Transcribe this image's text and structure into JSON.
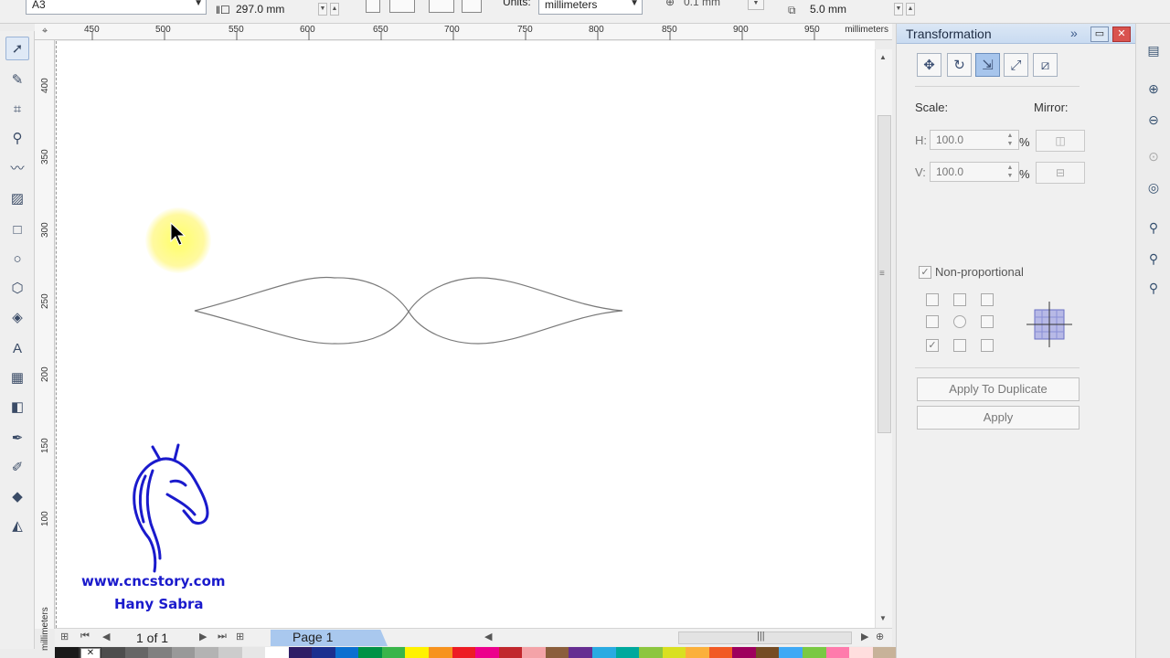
{
  "property_bar": {
    "paper_size": "A3",
    "page_height": "297.0 mm",
    "units_label": "Units:",
    "units_value": "millimeters",
    "nudge": "0.1 mm",
    "duplicate_offset": "5.0 mm"
  },
  "toolbox": {
    "tools": [
      "pick-tool-icon",
      "shape-tool-icon",
      "crop-tool-icon",
      "zoom-tool-icon",
      "freehand-tool-icon",
      "smart-fill-tool-icon",
      "rectangle-tool-icon",
      "ellipse-tool-icon",
      "polygon-tool-icon",
      "basic-shapes-tool-icon",
      "text-tool-icon",
      "table-tool-icon",
      "blend-tool-icon",
      "eyedropper-tool-icon",
      "outline-tool-icon",
      "fill-tool-icon",
      "interactive-fill-tool-icon"
    ]
  },
  "rulers": {
    "horizontal_ticks": [
      "450",
      "500",
      "550",
      "600",
      "650",
      "700",
      "750",
      "800",
      "850",
      "900",
      "950"
    ],
    "horizontal_unit": "millimeters",
    "vertical_ticks": [
      "400",
      "350",
      "300",
      "250",
      "200",
      "150",
      "100"
    ],
    "vertical_unit": "millimeters"
  },
  "logo": {
    "site": "www.cncstory.com",
    "author": "Hany Sabra"
  },
  "page_nav": {
    "count": "1 of 1",
    "current_tab": "Page 1"
  },
  "palette": {
    "colors": [
      "#1a1a1a",
      "#333333",
      "#4d4d4d",
      "#666666",
      "#808080",
      "#999999",
      "#b3b3b3",
      "#cccccc",
      "#e6e6e6",
      "#ffffff",
      "#2e1d66",
      "#1b2f8f",
      "#0b6fd0",
      "#009245",
      "#39b54a",
      "#fff200",
      "#f7931e",
      "#ed1c24",
      "#ec008c",
      "#c1272d",
      "#f4a3a8",
      "#8b5e3c",
      "#662d91",
      "#29abe2",
      "#00a99d",
      "#8cc63f",
      "#d9e021",
      "#fbb03b",
      "#f15a24",
      "#9e005d",
      "#754c24",
      "#3fa9f5",
      "#7ac943",
      "#ff7bac",
      "#ffdede",
      "#c7b299"
    ]
  },
  "docker": {
    "title": "Transformation",
    "scale_label": "Scale:",
    "mirror_label": "Mirror:",
    "h_label": "H:",
    "h_value": "100.0",
    "v_label": "V:",
    "v_value": "100.0",
    "percent": "%",
    "non_proportional_label": "Non-proportional",
    "apply_duplicate_label": "Apply To Duplicate",
    "apply_label": "Apply"
  }
}
